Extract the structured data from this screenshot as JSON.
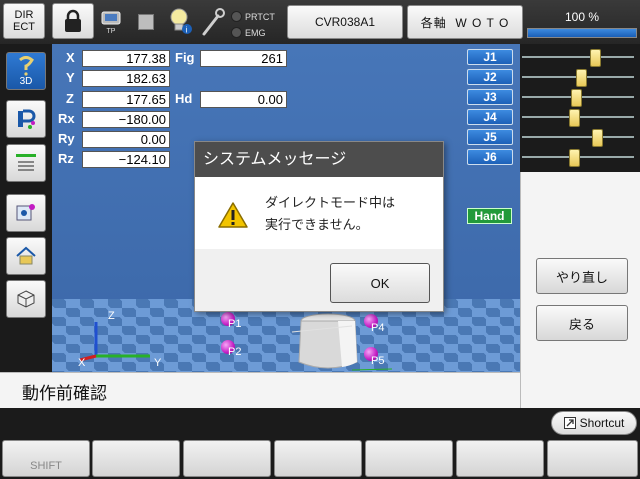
{
  "topbar": {
    "direct_label": "DIR\nECT",
    "tp_label": "TP",
    "protect_label": "PRTCT",
    "emg_label": "EMG",
    "program_label": "CVR038A1",
    "axis_label": "各軸  W O T O",
    "speed_label": "100 %",
    "speed_percent": 100
  },
  "sidebar": {
    "view3d_label": "3D",
    "buttons": [
      "3d-view",
      "point-edit",
      "settings-list",
      "point-add",
      "home",
      "object"
    ]
  },
  "coords": {
    "X": {
      "label": "X",
      "value": "177.38"
    },
    "Y": {
      "label": "Y",
      "value": "182.63"
    },
    "Z": {
      "label": "Z",
      "value": "177.65"
    },
    "Rx": {
      "label": "Rx",
      "value": "−180.00"
    },
    "Ry": {
      "label": "Ry",
      "value": "0.00"
    },
    "Rz": {
      "label": "Rz",
      "value": "−124.10"
    },
    "fig_label": "Fig",
    "fig_value": "261",
    "hd_label": "Hd",
    "hd_value": "0.00"
  },
  "joints": [
    {
      "label": "J1",
      "level": 0.66
    },
    {
      "label": "J2",
      "level": 0.52
    },
    {
      "label": "J3",
      "level": 0.48
    },
    {
      "label": "J4",
      "level": 0.46
    },
    {
      "label": "J5",
      "level": 0.68
    },
    {
      "label": "J6",
      "level": 0.46
    }
  ],
  "hand_label": "Hand",
  "scene": {
    "points": [
      "P1",
      "P2",
      "P4",
      "P5"
    ],
    "axis_z": "Z",
    "axis_y": "Y",
    "axis_x": "X"
  },
  "right_panel": {
    "redo_label": "やり直し",
    "back_label": "戻る"
  },
  "status_text": "動作前確認",
  "shortcut_label": "Shortcut",
  "fkeys": [
    "SHIFT",
    "",
    "",
    "",
    "",
    "",
    ""
  ],
  "dialog": {
    "title": "システムメッセージ",
    "line1": "ダイレクトモード中は",
    "line2": "実行できません。",
    "ok_label": "OK"
  },
  "colors": {
    "accent_blue": "#1c60b8",
    "hand_green": "#229a3a",
    "point_magenta": "#c21bc2"
  }
}
